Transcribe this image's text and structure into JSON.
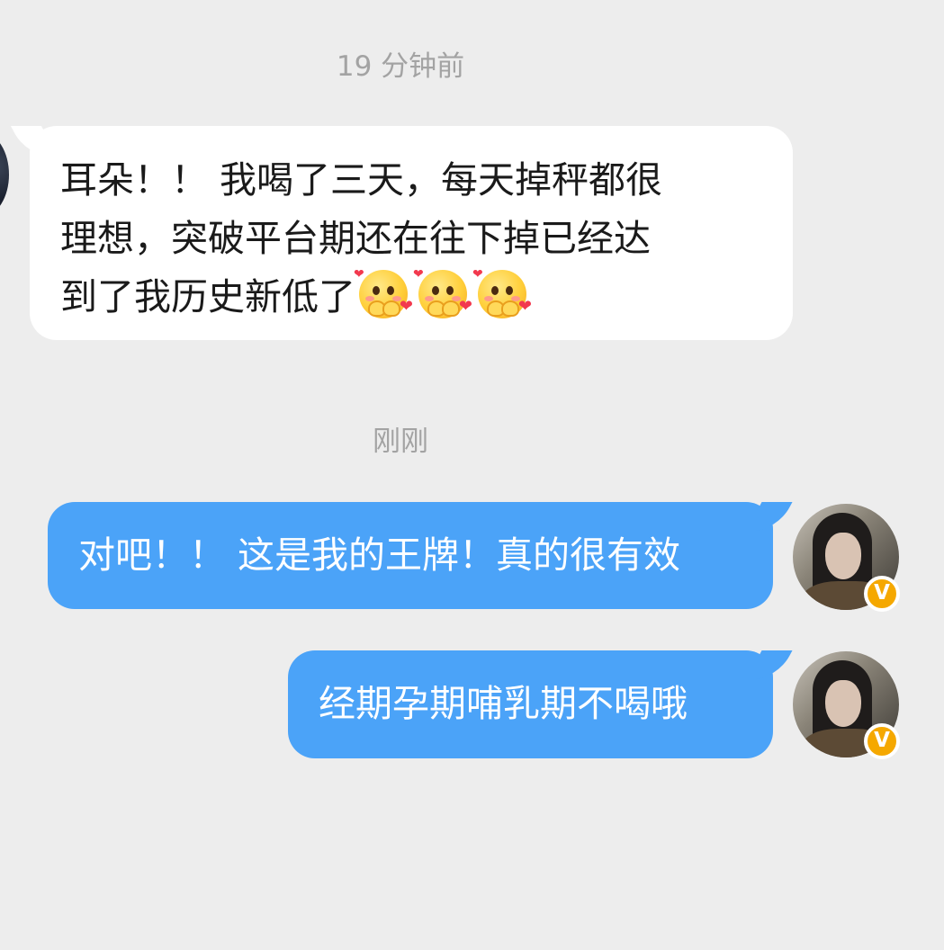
{
  "chat": {
    "timestamp_1": "19 分钟前",
    "incoming": {
      "lines": [
        "耳朵！！ 我喝了三天，每天掉秤都很",
        "理想，突破平台期还在往下掉已经达",
        "到了我历史新低了"
      ],
      "emojis": [
        "shy-face-emoji",
        "shy-face-emoji",
        "shy-face-emoji"
      ]
    },
    "timestamp_2": "刚刚",
    "outgoing": [
      {
        "text": "对吧！！ 这是我的王牌！真的很有效"
      },
      {
        "text": "经期孕期哺乳期不喝哦"
      }
    ],
    "verified_badge": "V"
  },
  "colors": {
    "background": "#ededed",
    "incoming_bubble": "#ffffff",
    "outgoing_bubble": "#4ba3f8",
    "timestamp_text": "#a3a3a3",
    "badge": "#f5a800"
  }
}
